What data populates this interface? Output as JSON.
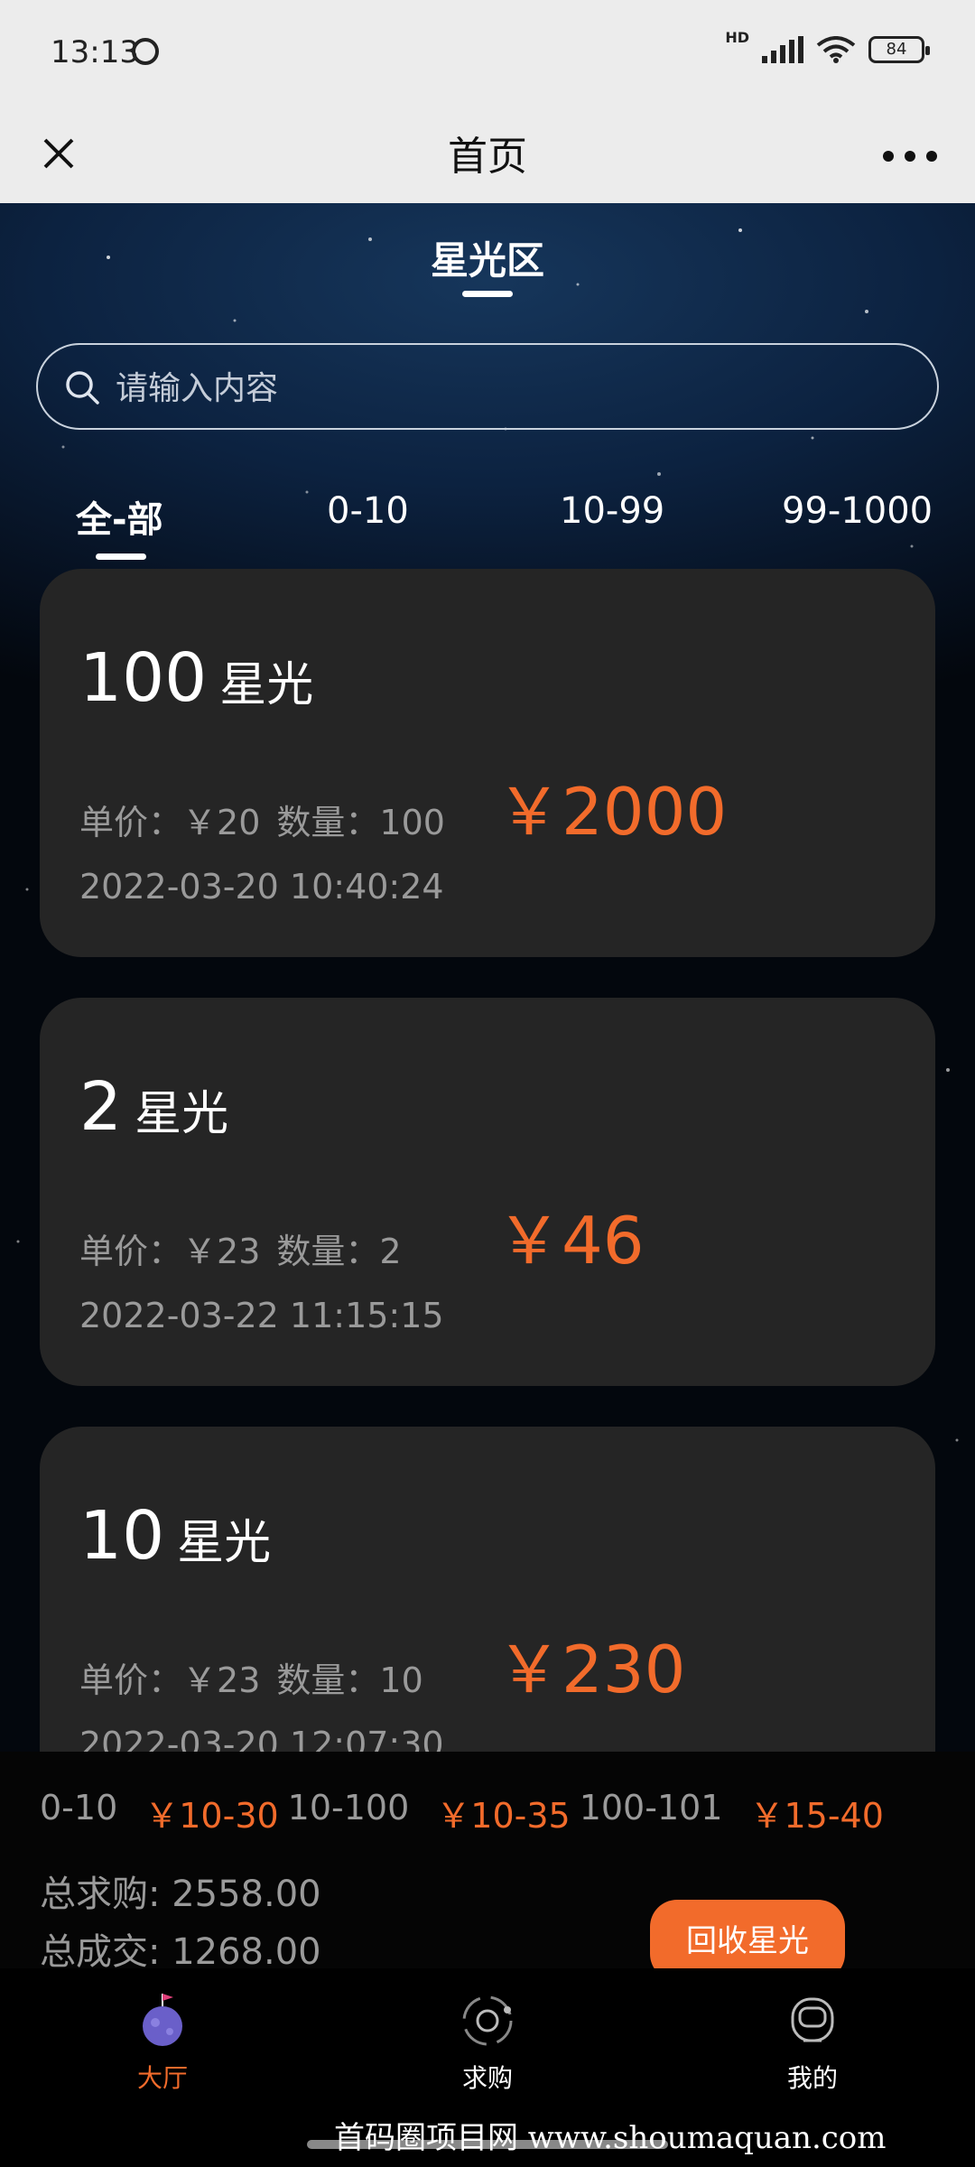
{
  "status_bar": {
    "time": "13:13",
    "hd_label": "HD",
    "battery": "84"
  },
  "navbar": {
    "title": "首页"
  },
  "section": {
    "title": "星光区"
  },
  "search": {
    "placeholder": "请输入内容"
  },
  "tabs": [
    "全-部",
    "0-10",
    "10-99",
    "99-1000"
  ],
  "cards": [
    {
      "amount": "100",
      "unit": "星光",
      "unit_price_label": "单价：",
      "unit_price": "￥20",
      "qty_label": "数量：",
      "qty": "100",
      "total": "￥2000",
      "date": "2022-03-20 10:40:24"
    },
    {
      "amount": "2",
      "unit": "星光",
      "unit_price_label": "单价：",
      "unit_price": "￥23",
      "qty_label": "数量：",
      "qty": "2",
      "total": "￥46",
      "date": "2022-03-22 11:15:15"
    },
    {
      "amount": "10",
      "unit": "星光",
      "unit_price_label": "单价：",
      "unit_price": "￥23",
      "qty_label": "数量：",
      "qty": "10",
      "total": "￥230",
      "date": "2022-03-20 12:07:30"
    }
  ],
  "bottom_panel": {
    "ranges": [
      {
        "range": "0-10",
        "price": "￥10-30"
      },
      {
        "range": "10-100",
        "price": "￥10-35"
      },
      {
        "range": "100-101",
        "price": "￥15-40"
      }
    ],
    "total_demand": "总求购: 2558.00",
    "total_deal": "总成交: 1268.00",
    "recycle_button": "回收星光"
  },
  "tabbar": {
    "items": [
      "大厅",
      "求购",
      "我的"
    ]
  },
  "watermark": "首码圈项目网 www.shoumaquan.com",
  "colors": {
    "accent": "#f26b2b",
    "card_bg": "#252525",
    "chrome_bg": "#ececec"
  },
  "icons": [
    "close-icon",
    "more-icon",
    "search-icon",
    "planet-icon",
    "orbit-icon",
    "astronaut-icon",
    "alarm-icon",
    "signal-icon",
    "wifi-icon",
    "battery-icon"
  ]
}
